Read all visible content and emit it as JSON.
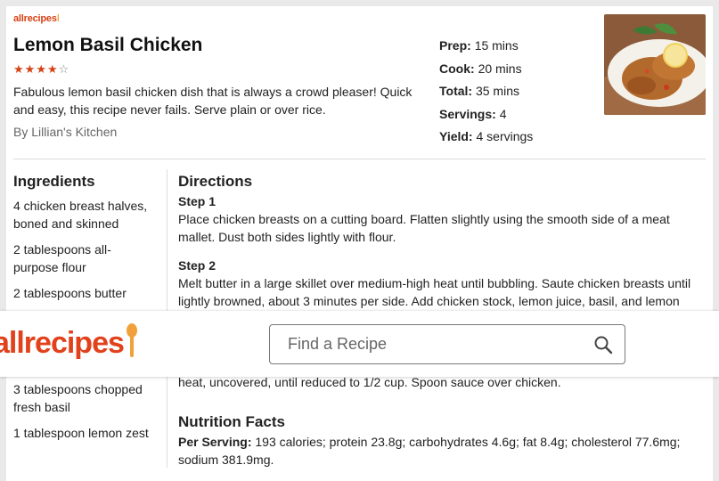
{
  "brand": {
    "name": "allrecipes"
  },
  "recipe": {
    "title": "Lemon Basil Chicken",
    "rating": 4,
    "rating_max": 5,
    "description": "Fabulous lemon basil chicken dish that is always a crowd pleaser! Quick and easy, this recipe never fails. Serve plain or over rice.",
    "author": "By Lillian's Kitchen"
  },
  "meta": [
    {
      "label": "Prep:",
      "value": "15 mins"
    },
    {
      "label": "Cook:",
      "value": "20 mins"
    },
    {
      "label": "Total:",
      "value": "35 mins"
    },
    {
      "label": "Servings:",
      "value": "4"
    },
    {
      "label": "Yield:",
      "value": "4 servings"
    }
  ],
  "ingredients": {
    "heading": "Ingredients",
    "items": [
      "4 chicken breast halves, boned and skinned",
      "2 tablespoons all-purpose flour",
      "2 tablespoons butter",
      "3 tablespoons chopped fresh basil",
      "1 tablespoon lemon zest"
    ]
  },
  "directions": {
    "heading": "Directions",
    "steps": [
      {
        "label": "Step 1",
        "text": "Place chicken breasts on a cutting board. Flatten slightly using the smooth side of a meat mallet. Dust both sides lightly with flour."
      },
      {
        "label": "Step 2",
        "text": "Melt butter in a large skillet over medium-high heat until bubbling. Saute chicken breasts until lightly browned, about 3 minutes per side. Add chicken stock, lemon juice, basil, and lemon"
      },
      {
        "label": "",
        "text": "heat, uncovered, until reduced to 1/2 cup. Spoon sauce over chicken."
      }
    ]
  },
  "nutrition": {
    "heading": "Nutrition Facts",
    "label": "Per Serving:",
    "text": "193 calories; protein 23.8g; carbohydrates 4.6g; fat 8.4g; cholesterol 77.6mg; sodium 381.9mg."
  },
  "search": {
    "placeholder": "Find a Recipe"
  },
  "colors": {
    "brand_orange": "#e1421c",
    "spoon": "#f0a13a",
    "star": "#d54215"
  },
  "icons": {
    "search": "search-icon",
    "star": "star-icon",
    "spoon": "spoon-icon"
  }
}
